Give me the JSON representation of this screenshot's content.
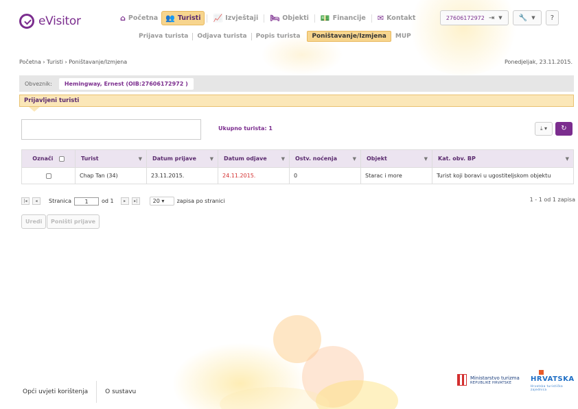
{
  "header": {
    "logo_text": "eVisitor",
    "nav": [
      {
        "icon": "home-icon",
        "label": "Početna",
        "active": false
      },
      {
        "icon": "users-icon",
        "label": "Turisti",
        "active": true
      },
      {
        "icon": "chart-icon",
        "label": "Izvještaji",
        "active": false
      },
      {
        "icon": "bed-icon",
        "label": "Objekti",
        "active": false
      },
      {
        "icon": "money-icon",
        "label": "Financije",
        "active": false
      },
      {
        "icon": "mail-icon",
        "label": "Kontakt",
        "active": false
      }
    ],
    "subnav": [
      {
        "label": "Prijava turista",
        "active": false
      },
      {
        "label": "Odjava turista",
        "active": false
      },
      {
        "label": "Popis turista",
        "active": false
      },
      {
        "label": "Poništavanje/Izmjena",
        "active": true
      },
      {
        "label": "MUP",
        "active": false
      }
    ],
    "account_id": "27606172972"
  },
  "breadcrumb": [
    "Početna",
    "Turisti",
    "Poništavanje/Izmjena"
  ],
  "date": "Ponedjeljak, 23.11.2015.",
  "obveznik": {
    "label": "Obveznik:",
    "value": "Hemingway, Ernest (OIB:27606172972 )"
  },
  "section_title": "Prijavljeni turisti",
  "ukupno": "Ukupno turista: 1",
  "table": {
    "columns": [
      "Označi",
      "Turist",
      "Datum prijave",
      "Datum odjave",
      "Ostv. noćenja",
      "Objekt",
      "Kat. obv. BP"
    ],
    "rows": [
      {
        "turist": "Chap Tan (34)",
        "prijava": "23.11.2015.",
        "odjava": "24.11.2015.",
        "nocenja": "0",
        "objekt": "Starac i more",
        "kat": "Turist koji boravi u ugostiteljskom objektu"
      }
    ]
  },
  "pager": {
    "page_label": "Stranica",
    "page": "1",
    "of_label": "od 1",
    "page_size": "20",
    "size_label": "zapisa po stranici",
    "count": "1 - 1 od 1 zapisa"
  },
  "actions": {
    "edit": "Uredi",
    "cancel": "Poništi prijave"
  },
  "footer": {
    "terms": "Opći uvjeti korištenja",
    "about": "O sustavu",
    "ministry_line1": "Ministarstvo turizma",
    "ministry_line2": "REPUBLIKE HRVATSKE",
    "brand": "HRVATSKA",
    "brand_sub": "Hrvatska turistička zajednica"
  },
  "colors": {
    "accent": "#7b2d8e",
    "highlight": "#f7d58e",
    "odjava_red": "#d32f2f"
  }
}
